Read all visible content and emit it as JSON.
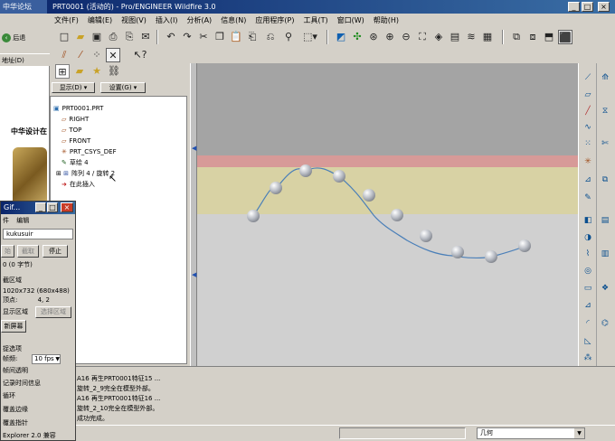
{
  "window": {
    "title": "PRT0001 (活动的) - Pro/ENGINEER Wildfire 3.0",
    "left_tab": "中华论坛",
    "minimize": "_",
    "maximize": "□",
    "close": "×"
  },
  "menu": [
    "文件(F)",
    "编辑(E)",
    "视图(V)",
    "插入(I)",
    "分析(A)",
    "信息(N)",
    "应用程序(P)",
    "工具(T)",
    "窗口(W)",
    "帮助(H)"
  ],
  "browser_left": {
    "back_label": "后退",
    "address_label": "地址(D)",
    "page_heading": "中华设计在"
  },
  "panel": {
    "display_btn": "显示(D)",
    "settings_btn": "设置(G)"
  },
  "model_tree": [
    {
      "label": "PRT0001.PRT",
      "icon": "part-icon"
    },
    {
      "label": "RIGHT",
      "icon": "datum-plane-icon"
    },
    {
      "label": "TOP",
      "icon": "datum-plane-icon"
    },
    {
      "label": "FRONT",
      "icon": "datum-plane-icon"
    },
    {
      "label": "PRT_CSYS_DEF",
      "icon": "csys-icon"
    },
    {
      "label": "草绘 4",
      "icon": "sketch-icon"
    },
    {
      "label": "阵列 4 / 旋转 2",
      "icon": "pattern-icon"
    },
    {
      "label": "在此插入",
      "icon": "insert-arrow-icon"
    }
  ],
  "messages": [
    "A16 再生PRT0001特征15 ...",
    "旋转_2_9完全在模型外部。",
    "A16 再生PRT0001特征16 ...",
    "旋转_2_10完全在模型外部。",
    "成功完成。"
  ],
  "filter": {
    "value": "几何"
  },
  "gif_window": {
    "title": "Gif...",
    "menu_file": "件",
    "menu_edit": "编辑",
    "name_field": "kukusuir",
    "btn_record": "始",
    "btn_capture": "截取",
    "btn_stop": "停止",
    "size_text": "0 (0 字节)",
    "region_group": "截区域",
    "resolution_label": "1020x732",
    "resolution_value": "(680x488)",
    "vertex_label": "顶点:",
    "vertex_value": "4, 2",
    "display_region": "显示区域",
    "select_region": "选择区域",
    "refresh_btn": "新屏幕",
    "options_group": "捉选项",
    "fps_label": "帧频:",
    "fps_value": "10 fps",
    "opt1": "帧间透明",
    "opt2": "记录时间信息",
    "opt3": "循环",
    "opt4": "覆盖边缘",
    "opt5": "覆盖指针",
    "footer": "Explorer 2.0 兼容"
  },
  "colors": {
    "title_blue": "#0a246a",
    "viewport_top": "#a4a4a4",
    "band_pink": "#d79a98",
    "band_tan": "#d8d2a4",
    "viewport_bottom": "#d0d0d0"
  }
}
